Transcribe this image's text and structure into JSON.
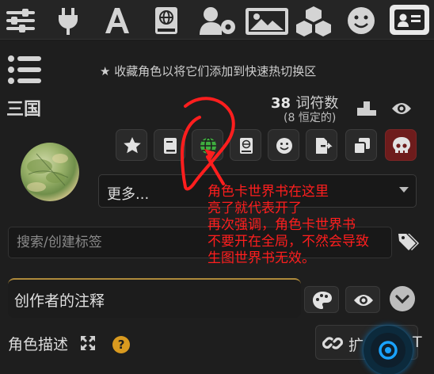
{
  "top_nav": {
    "icons": [
      "sliders-icon",
      "plug-icon",
      "font-icon",
      "book-globe-icon",
      "user-gear-icon",
      "image-icon",
      "cubes-icon",
      "smile-icon",
      "address-card-icon"
    ],
    "active": "address-card-icon"
  },
  "panel": {
    "favorite_hint": "收藏角色以将它们添加到快速热切换区",
    "character_name": "三国",
    "token_count": "38",
    "token_unit": "词符数",
    "permanent_tokens": "(8 恒定的)",
    "more_select": {
      "value": "更多...",
      "options": [
        "更多..."
      ]
    },
    "tag_search": {
      "placeholder": "搜索/创建标签",
      "value": ""
    },
    "creator_notes_label": "创作者的注释",
    "char_description_label": "角色描述",
    "expand_button_label": "扩",
    "expand_trailing_text": "T"
  },
  "annotation": {
    "text": "角色卡世界书在这里\n亮了就代表开了\n再次强调，角色卡世界书\n不要开在全局，不然会导致\n生图世界书无效。"
  },
  "colors": {
    "accent_green": "#3fae3f",
    "danger_red": "#6e1c1c",
    "annotation_red": "#ff1e1e",
    "fab_blue": "#1aa3ff"
  }
}
